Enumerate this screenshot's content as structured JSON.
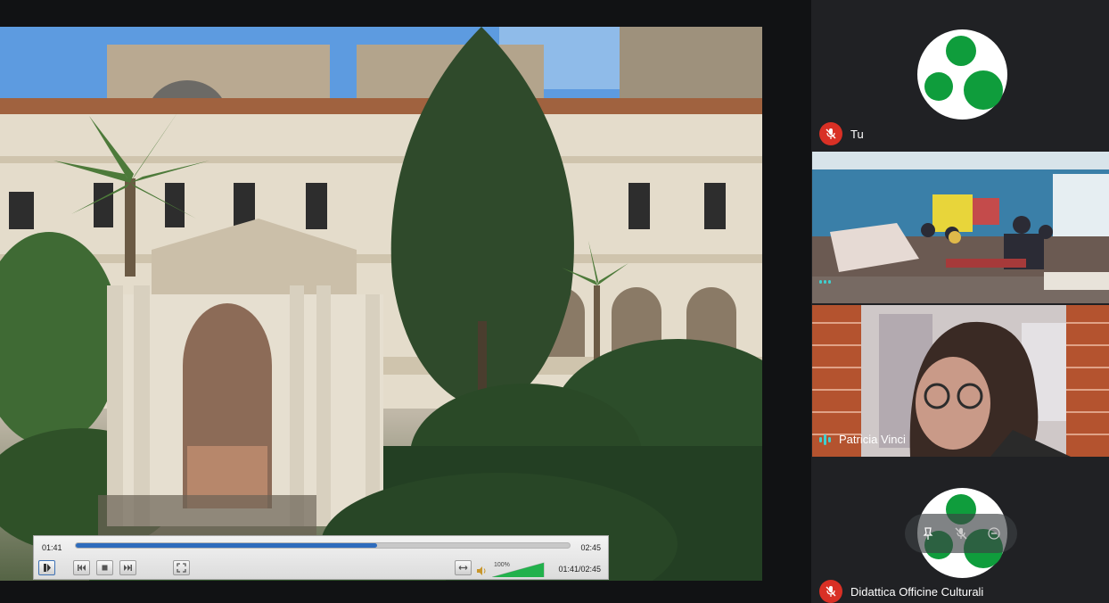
{
  "presentation": {
    "player": {
      "elapsed": "01:41",
      "total": "02:45",
      "combined": "01:41/02:45",
      "progress": 0.61,
      "volume_label": "100%",
      "volume_level": 1.0,
      "buttons": {
        "play": "play-pause",
        "previous": "skip-back",
        "stop": "stop",
        "next": "skip-forward",
        "fullscreen": "fullscreen",
        "loop": "loop",
        "volume": "volume"
      }
    }
  },
  "participants": {
    "tu": {
      "name": "Tu",
      "muted": true,
      "avatar_color": "#0f9d3c"
    },
    "classroom": {
      "speaking": true
    },
    "patricia": {
      "name": "Patricia Vinci",
      "speaking": true
    },
    "didattica": {
      "name": "Didattica Officine Culturali",
      "muted": true,
      "avatar_color": "#0f9d3c"
    }
  },
  "colors": {
    "background": "#202124",
    "mute_red": "#d93025",
    "talk_cyan": "#3fd0d0",
    "seek_blue": "#2e6cbd",
    "volume_green": "#22b14c"
  }
}
